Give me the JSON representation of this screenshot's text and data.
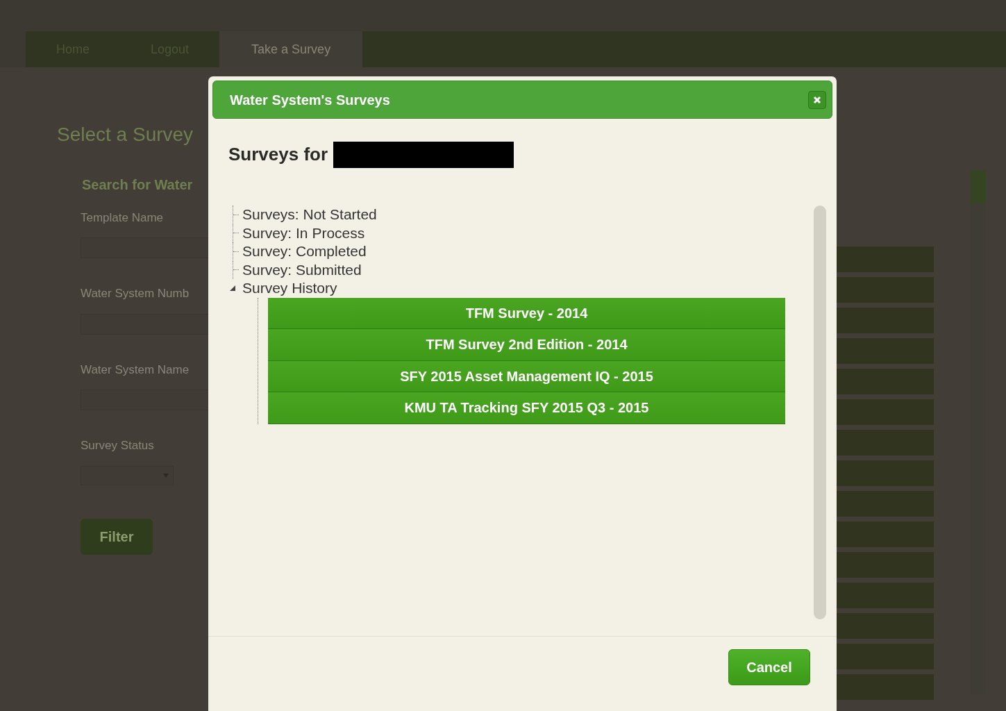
{
  "nav": {
    "tabs": [
      {
        "label": "Home",
        "selected": false
      },
      {
        "label": "Logout",
        "selected": false
      },
      {
        "label": "Take a Survey",
        "selected": true
      }
    ]
  },
  "page": {
    "title": "Select a Survey",
    "search_heading": "Search for Water",
    "fields": [
      {
        "label": "Template Name",
        "kind": "text"
      },
      {
        "label": "Water System Numb",
        "kind": "text"
      },
      {
        "label": "Water System Name",
        "kind": "text"
      },
      {
        "label": "Survey Status",
        "kind": "select"
      }
    ],
    "filter_button": "Filter"
  },
  "modal": {
    "title": "Water System's Surveys",
    "heading": "Surveys for",
    "tree": [
      {
        "label": "Surveys: Not Started"
      },
      {
        "label": "Survey: In Process"
      },
      {
        "label": "Survey: Completed"
      },
      {
        "label": "Survey: Submitted"
      },
      {
        "label": "Survey History",
        "expanded": true,
        "children": [
          {
            "label": "TFM Survey - 2014"
          },
          {
            "label": "TFM Survey 2nd Edition - 2014"
          },
          {
            "label": "SFY 2015 Asset Management IQ - 2015"
          },
          {
            "label": "KMU TA Tracking SFY 2015 Q3 - 2015"
          }
        ]
      }
    ],
    "buttons": [
      "Cancel"
    ]
  }
}
